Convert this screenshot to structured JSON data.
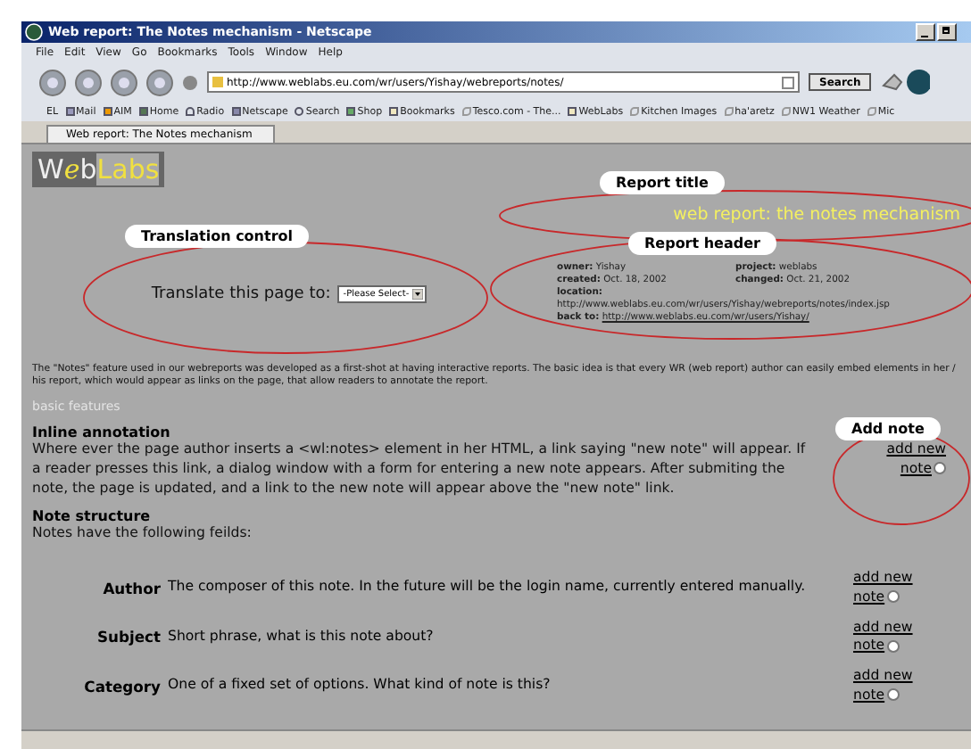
{
  "window": {
    "title": "Web report: The Notes mechanism - Netscape"
  },
  "menu": [
    "File",
    "Edit",
    "View",
    "Go",
    "Bookmarks",
    "Tools",
    "Window",
    "Help"
  ],
  "toolbar": {
    "url": "http://www.weblabs.eu.com/wr/users/Yishay/webreports/notes/",
    "search_button": "Search"
  },
  "bookmarks": [
    {
      "label": "EL",
      "kind": "plain"
    },
    {
      "label": "Mail",
      "kind": "mail"
    },
    {
      "label": "AIM",
      "kind": "person"
    },
    {
      "label": "Home",
      "kind": "home"
    },
    {
      "label": "Radio",
      "kind": "radio"
    },
    {
      "label": "Netscape",
      "kind": "page"
    },
    {
      "label": "Search",
      "kind": "search"
    },
    {
      "label": "Shop",
      "kind": "shop"
    },
    {
      "label": "Bookmarks",
      "kind": "folder"
    },
    {
      "label": "Tesco.com - The...",
      "kind": "link"
    },
    {
      "label": "WebLabs",
      "kind": "folder"
    },
    {
      "label": "Kitchen Images",
      "kind": "link"
    },
    {
      "label": "ha'aretz",
      "kind": "link"
    },
    {
      "label": "NW1 Weather",
      "kind": "link"
    },
    {
      "label": "Mic",
      "kind": "link"
    }
  ],
  "tabs": [
    {
      "label": "Web report: The Notes mechanism",
      "selected": true
    }
  ],
  "page": {
    "logo": {
      "mark": [
        "W",
        "e",
        "b"
      ],
      "name": "Labs"
    },
    "report_title": "web report: the notes mechanism",
    "translate": {
      "label": "Translate this page to:",
      "select": "-Please Select-"
    },
    "header": {
      "owner_label": "owner:",
      "owner": "Yishay",
      "project_label": "project:",
      "project": "weblabs",
      "created_label": "created:",
      "created": "Oct. 18, 2002",
      "changed_label": "changed:",
      "changed": "Oct. 21, 2002",
      "location_label": "location:",
      "location": "http://www.weblabs.eu.com/wr/users/Yishay/webreports/notes/index.jsp",
      "back_label": "back to:",
      "back": "http://www.weblabs.eu.com/wr/users/Yishay/"
    },
    "intro": "The \"Notes\" feature used in our webreports was developed as a first-shot at having interactive reports. The basic idea is that every WR (web report) author can easily embed elements in her / his report, which would appear as links on the page, that allow readers to annotate the report.",
    "section": "basic features",
    "inline_heading": "Inline annotation",
    "inline_text": "Where ever the page author inserts a <wl:notes> element in her HTML, a link saying \"new note\" will appear. If a reader presses this link, a dialog window with a form for entering a new note appears. After submiting the note, the page is updated, and a link to the new note will appear above the \"new note\" link.",
    "inline_link": "add new note",
    "structure_heading": "Note structure",
    "structure_text": "Notes have the following feilds:",
    "fields": [
      {
        "name": "Author",
        "description": "The composer of this note. In the future will be the login name, currently entered manually.",
        "link": "add new note"
      },
      {
        "name": "Subject",
        "description": "Short phrase, what is this note about?",
        "link": "add new note"
      },
      {
        "name": "Category",
        "description": "One of a fixed set of options. What kind of note is this?",
        "link": "add new note"
      }
    ]
  },
  "annotations": [
    {
      "label": "Translation control",
      "kind": "translate"
    },
    {
      "label": "Report title",
      "kind": "title"
    },
    {
      "label": "Report header",
      "kind": "header"
    },
    {
      "label": "Add note",
      "kind": "note"
    }
  ]
}
